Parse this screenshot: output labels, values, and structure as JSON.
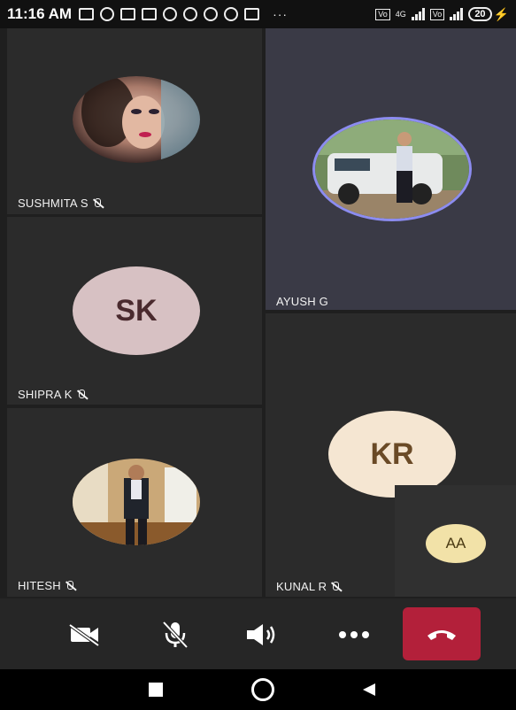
{
  "status_bar": {
    "time": "11:16 AM",
    "battery": "20",
    "network": "4G"
  },
  "participants": {
    "sushmita": {
      "name": "SUSHMITA S",
      "muted": true
    },
    "ayush": {
      "name": "AYUSH G",
      "muted": false,
      "active_speaker": true
    },
    "shipra": {
      "name": "SHIPRA K",
      "initials": "SK",
      "muted": true
    },
    "kunal": {
      "name": "KUNAL R",
      "initials": "KR",
      "muted": true
    },
    "hitesh": {
      "name": "HITESH",
      "muted": true
    },
    "self": {
      "initials": "AA"
    }
  },
  "controls": {
    "icons": [
      "camera-off-icon",
      "microphone-off-icon",
      "speaker-icon",
      "more-icon",
      "end-call-icon"
    ]
  },
  "navigation": {
    "icons": [
      "recent-apps-icon",
      "home-icon",
      "back-icon"
    ]
  },
  "colors": {
    "end_call": "#b3203a",
    "tile_bg": "#2b2b2b",
    "active_tile_bg": "#3a3a46",
    "active_ring": "#8c8cf0",
    "sk_avatar": "#d7c1c3",
    "kr_avatar": "#f5e6d2",
    "aa_avatar": "#f2e2a8"
  }
}
